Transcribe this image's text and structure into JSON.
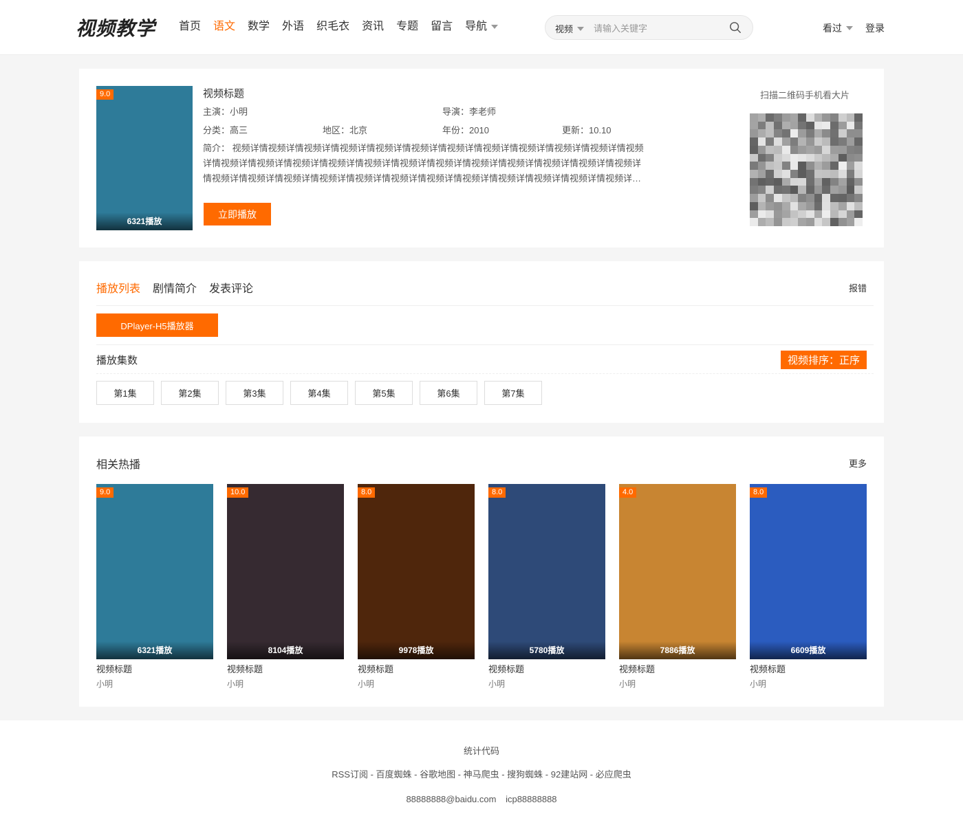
{
  "header": {
    "logo": "视频教学",
    "nav": [
      {
        "label": "首页",
        "active": false
      },
      {
        "label": "语文",
        "active": true
      },
      {
        "label": "数学",
        "active": false
      },
      {
        "label": "外语",
        "active": false
      },
      {
        "label": "织毛衣",
        "active": false
      },
      {
        "label": "资讯",
        "active": false
      },
      {
        "label": "专题",
        "active": false
      },
      {
        "label": "留言",
        "active": false
      },
      {
        "label": "导航",
        "active": false,
        "dropdown": true
      }
    ],
    "search_type": "视频",
    "search_placeholder": "请输入关键字",
    "history_label": "看过",
    "login_label": "登录"
  },
  "detail": {
    "score": "9.0",
    "plays": "6321播放",
    "poster_color": "#2e7b99",
    "title": "视频标题",
    "actor_label": "主演：小明",
    "director_label": "导演：李老师",
    "category_label": "分类：高三",
    "region_label": "地区：北京",
    "year_label": "年份：2010",
    "update_label": "更新：10.10",
    "desc_line1": "简介：  视频详情视频详情视频详情视频详情视频详情视频详情视频详情视频详情视频详情视频详情视频详情视频",
    "desc_line2": "详情视频详情视频详情视频详情视频详情视频详情视频详情视频详情视频详情视频详情视频详情视频详情视频详",
    "desc_line3": "情视频详情视频详情视频详情视频详情视频详情视频详情视频详情视频详情视频详情视频详情视频详情视频详…",
    "play_button": "立即播放",
    "qr_label": "扫描二维码手机看大片"
  },
  "playlist": {
    "tabs": [
      {
        "label": "播放列表",
        "active": true
      },
      {
        "label": "剧情简介",
        "active": false
      },
      {
        "label": "发表评论",
        "active": false
      }
    ],
    "report": "报错",
    "player_button": "DPlayer-H5播放器",
    "episodes_label": "播放集数",
    "sort_button": "视频排序：正序",
    "episodes": [
      "第1集",
      "第2集",
      "第3集",
      "第4集",
      "第5集",
      "第6集",
      "第7集"
    ]
  },
  "related": {
    "title": "相关热播",
    "more": "更多",
    "items": [
      {
        "score": "9.0",
        "plays": "6321播放",
        "title": "视频标题",
        "actor": "小明",
        "color": "#2e7b99"
      },
      {
        "score": "10.0",
        "plays": "8104播放",
        "title": "视频标题",
        "actor": "小明",
        "color": "#362a31"
      },
      {
        "score": "8.0",
        "plays": "9978播放",
        "title": "视频标题",
        "actor": "小明",
        "color": "#4f260c"
      },
      {
        "score": "8.0",
        "plays": "5780播放",
        "title": "视频标题",
        "actor": "小明",
        "color": "#2e4a78"
      },
      {
        "score": "4.0",
        "plays": "7886播放",
        "title": "视频标题",
        "actor": "小明",
        "color": "#c88532"
      },
      {
        "score": "8.0",
        "plays": "6609播放",
        "title": "视频标题",
        "actor": "小明",
        "color": "#2b5cbf"
      }
    ]
  },
  "footer": {
    "stats": "统计代码",
    "links": "RSS订阅 - 百度蜘蛛 - 谷歌地图 - 神马爬虫 - 搜狗蜘蛛 - 92建站网 - 必应爬虫",
    "email": "88888888@baidu.com",
    "icp": "icp88888888"
  },
  "colors": {
    "accent": "#ff6a00"
  }
}
